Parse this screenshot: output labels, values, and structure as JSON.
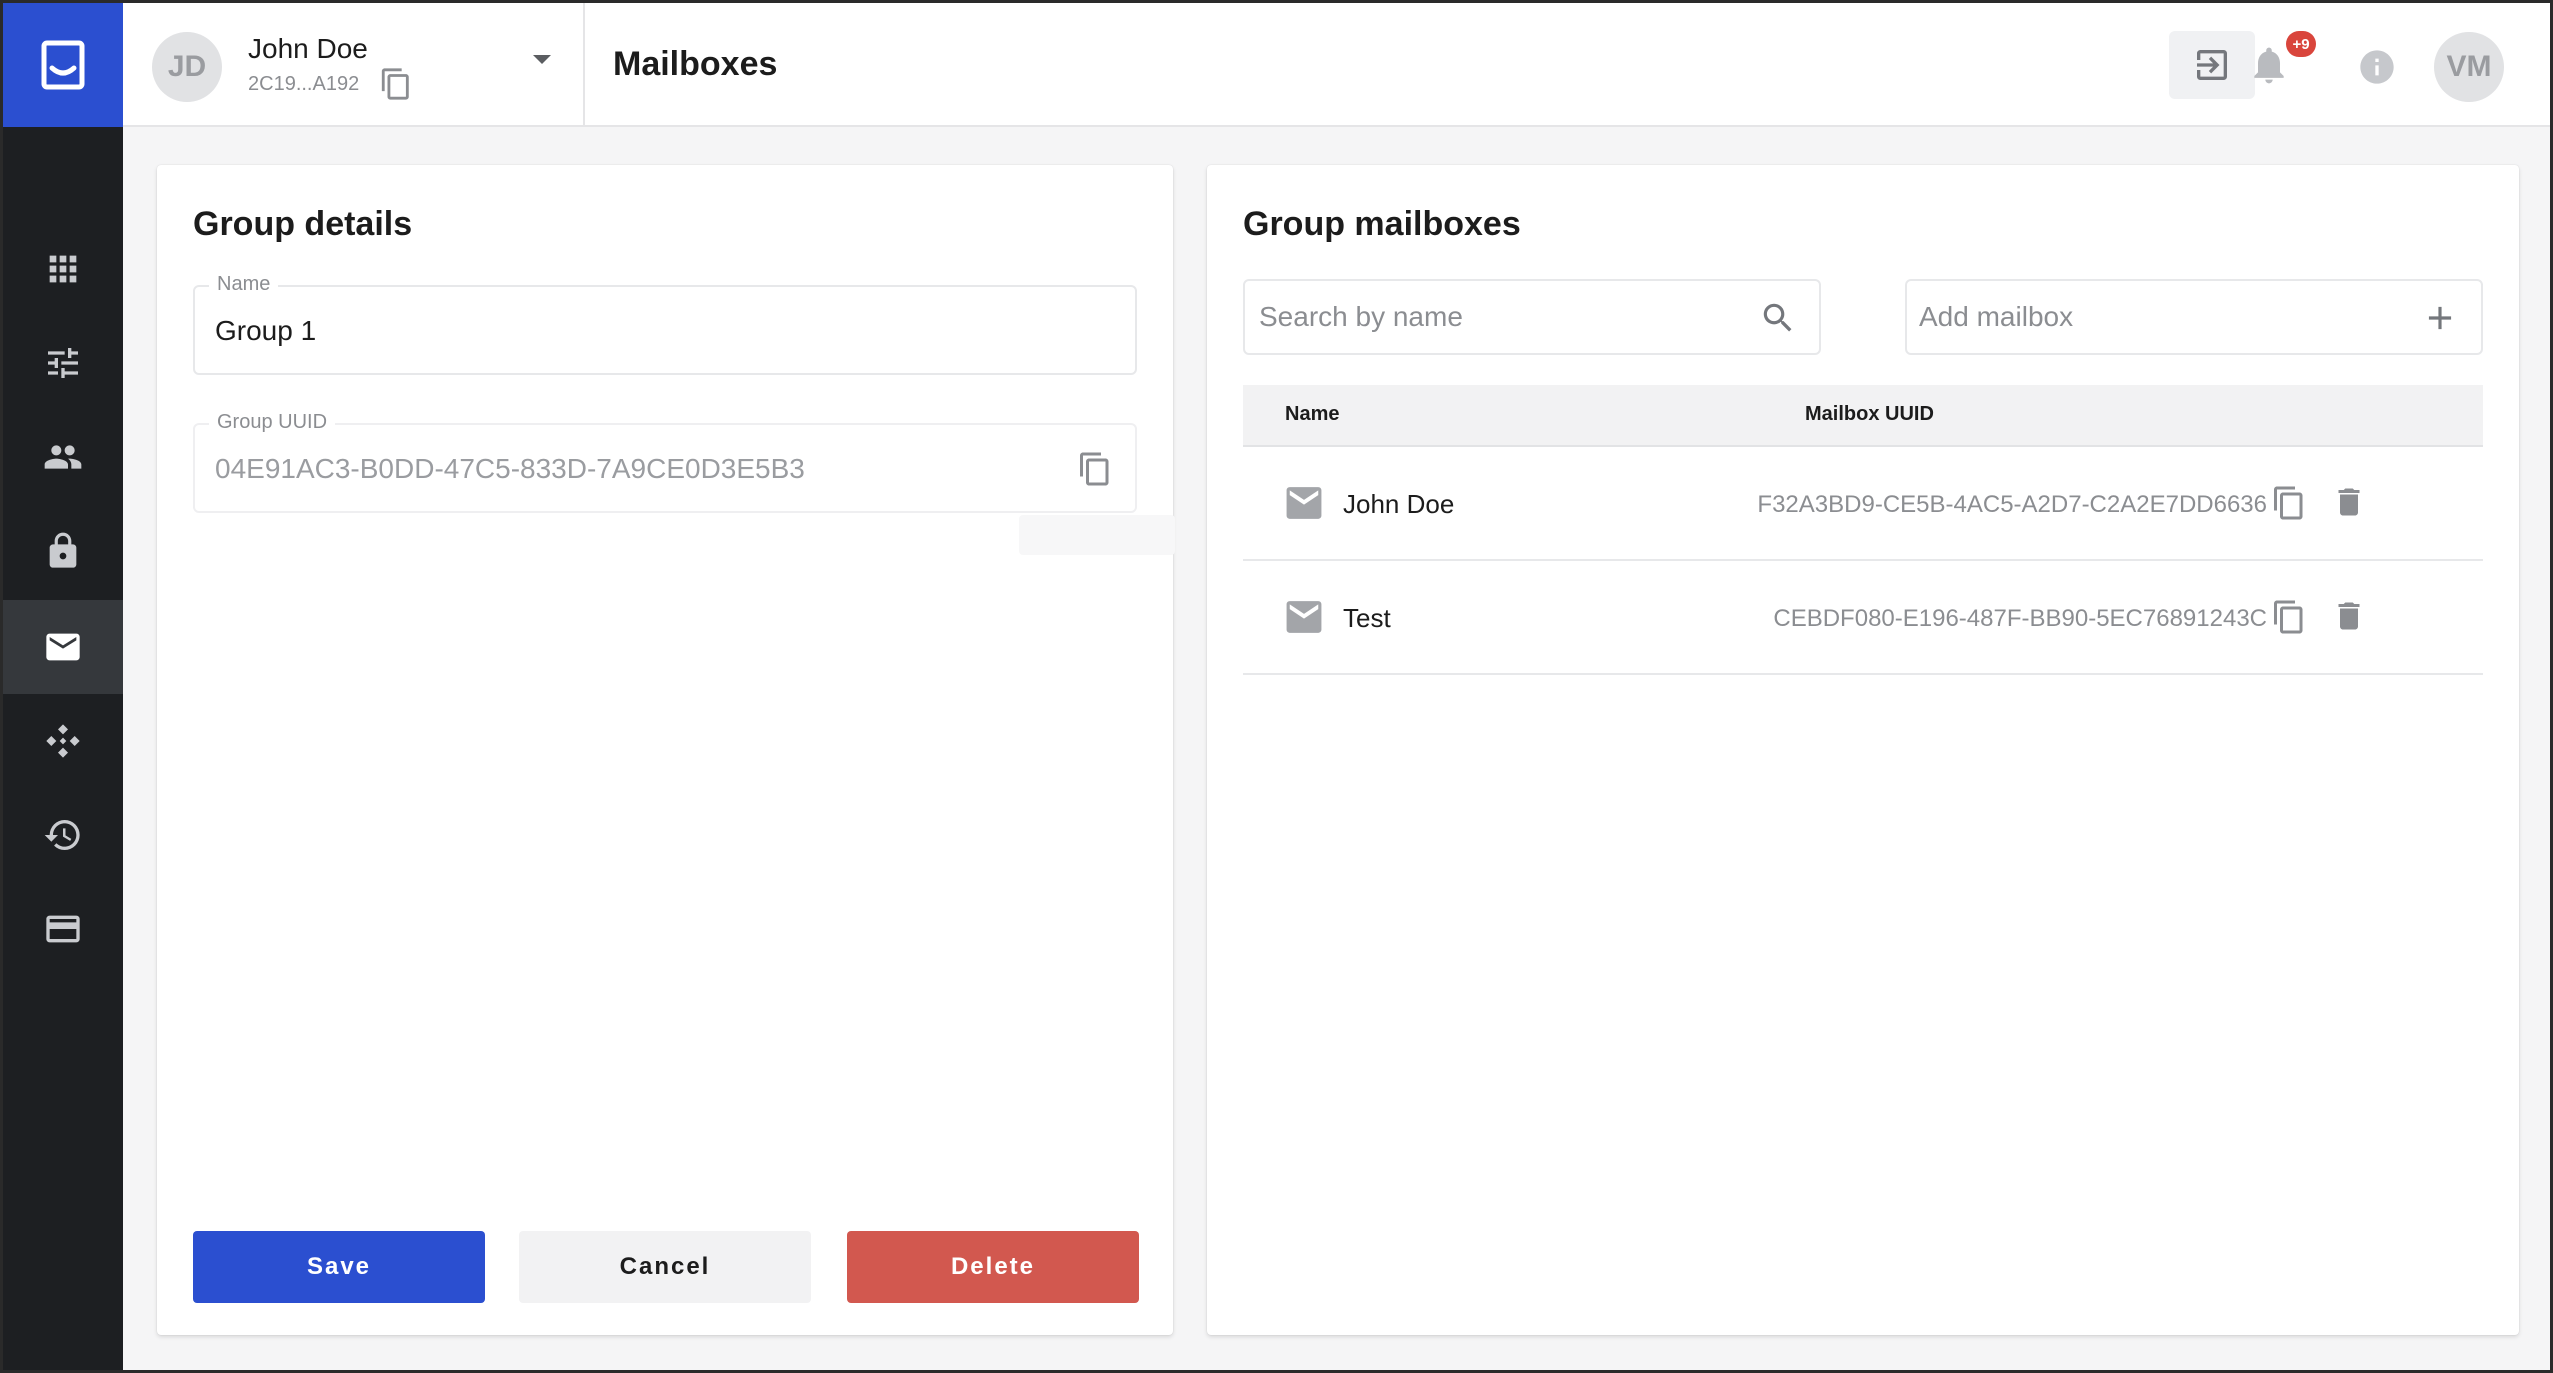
{
  "user": {
    "initials": "JD",
    "name": "John Doe",
    "id_short": "2C19...A192"
  },
  "header": {
    "title": "Mailboxes",
    "notification_badge": "+9",
    "account_initials": "VM"
  },
  "sidebar": {
    "items": [
      {
        "icon": "apps-grid-icon",
        "active": false
      },
      {
        "icon": "tune-sliders-icon",
        "active": false
      },
      {
        "icon": "people-icon",
        "active": false
      },
      {
        "icon": "lock-icon",
        "active": false
      },
      {
        "icon": "mail-icon",
        "active": true
      },
      {
        "icon": "workflow-icon",
        "active": false
      },
      {
        "icon": "history-icon",
        "active": false
      },
      {
        "icon": "credit-card-icon",
        "active": false
      }
    ]
  },
  "group_details": {
    "title": "Group details",
    "name_label": "Name",
    "name_value": "Group 1",
    "uuid_label": "Group UUID",
    "uuid_value": "04E91AC3-B0DD-47C5-833D-7A9CE0D3E5B3",
    "save_label": "Save",
    "cancel_label": "Cancel",
    "delete_label": "Delete"
  },
  "group_mailboxes": {
    "title": "Group mailboxes",
    "search_placeholder": "Search by name",
    "add_placeholder": "Add mailbox",
    "columns": [
      "Name",
      "Mailbox UUID"
    ],
    "rows": [
      {
        "name": "John Doe",
        "uuid": "F32A3BD9-CE5B-4AC5-A2D7-C2A2E7DD6636"
      },
      {
        "name": "Test",
        "uuid": "CEBDF080-E196-487F-BB90-5EC76891243C"
      }
    ]
  },
  "colors": {
    "brand": "#2b4fd0",
    "sidebar_bg": "#1d1f22",
    "danger": "#d2584f",
    "badge": "#d9453c"
  }
}
